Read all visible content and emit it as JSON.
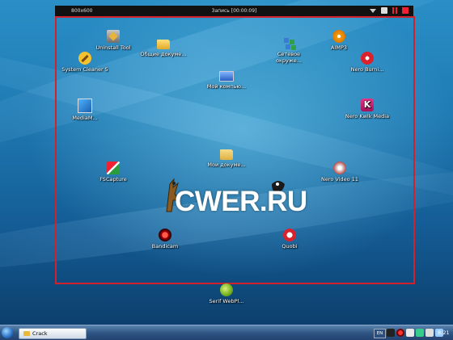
{
  "recorder": {
    "resolution": "800x600",
    "title": "Запись [00:00:09]"
  },
  "desktop_icons": [
    {
      "id": "uninstall-tool",
      "label": "Uninstall Tool",
      "icon": "uninstall-tool-icon"
    },
    {
      "id": "shared-docs",
      "label": "Общие докуме...",
      "icon": "folder-icon"
    },
    {
      "id": "network",
      "label": "Сетевое окруже...",
      "icon": "network-icon"
    },
    {
      "id": "aimp",
      "label": "AIMP3",
      "icon": "aimp-icon"
    },
    {
      "id": "system-cleaner",
      "label": "System Cleaner 5",
      "icon": "system-cleaner-icon"
    },
    {
      "id": "nero-burning",
      "label": "Nero Burni...",
      "icon": "nero-icon"
    },
    {
      "id": "my-computer",
      "label": "Мой компью...",
      "icon": "computer-icon"
    },
    {
      "id": "mediamonkey",
      "label": "MediaM...",
      "icon": "media-icon"
    },
    {
      "id": "nero-kwik",
      "label": "Nero Kwik Media",
      "icon": "nero-kwik-icon"
    },
    {
      "id": "fscapture",
      "label": "FSCapture",
      "icon": "fscapture-icon"
    },
    {
      "id": "my-documents",
      "label": "Мои докуме...",
      "icon": "documents-folder-icon"
    },
    {
      "id": "nero-video",
      "label": "Nero Video 11",
      "icon": "nero-video-icon"
    },
    {
      "id": "bandicam",
      "label": "Bandicam",
      "icon": "bandicam-icon"
    },
    {
      "id": "quobi",
      "label": "Quobi",
      "icon": "quobi-icon"
    },
    {
      "id": "serif-webplus",
      "label": "Serif WebPl...",
      "icon": "serif-icon"
    }
  ],
  "logo": {
    "text": "CWER.RU"
  },
  "taskbar": {
    "task_label": "Crack",
    "language": "EN",
    "clock": "8:21"
  }
}
